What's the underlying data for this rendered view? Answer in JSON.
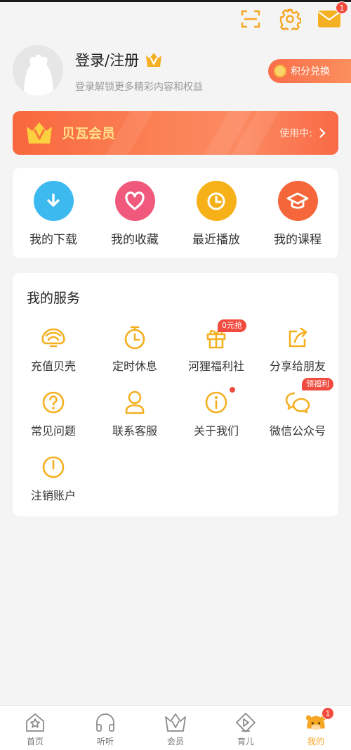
{
  "header": {
    "scan_icon": "scan-icon",
    "settings_icon": "gear-icon",
    "mail_icon": "mail-icon",
    "mail_badge": "1"
  },
  "profile": {
    "login_text": "登录/注册",
    "subtitle": "登录解锁更多精彩内容和权益",
    "points_label": "积分兑换"
  },
  "member": {
    "title": "贝瓦会员",
    "status": "使用中:"
  },
  "shortcuts": [
    {
      "label": "我的下载",
      "icon": "download-icon",
      "color": "#3cb9ef"
    },
    {
      "label": "我的收藏",
      "icon": "heart-icon",
      "color": "#f0597c"
    },
    {
      "label": "最近播放",
      "icon": "clock-icon",
      "color": "#f7b118"
    },
    {
      "label": "我的课程",
      "icon": "graduation-cap-icon",
      "color": "#f5673a"
    }
  ],
  "services": {
    "title": "我的服务",
    "items": [
      {
        "label": "充值贝壳",
        "icon": "shell-icon"
      },
      {
        "label": "定时休息",
        "icon": "timer-icon"
      },
      {
        "label": "河狸福利社",
        "icon": "gift-box-icon",
        "tag": "0元抢"
      },
      {
        "label": "分享给朋友",
        "icon": "share-icon"
      },
      {
        "label": "常见问题",
        "icon": "question-icon"
      },
      {
        "label": "联系客服",
        "icon": "customer-service-icon"
      },
      {
        "label": "关于我们",
        "icon": "info-icon"
      },
      {
        "label": "微信公众号",
        "icon": "wechat-icon",
        "tag": "领福利"
      },
      {
        "label": "注销账户",
        "icon": "power-icon"
      }
    ]
  },
  "nav": [
    {
      "label": "首页",
      "icon": "home-icon"
    },
    {
      "label": "听听",
      "icon": "headphones-icon"
    },
    {
      "label": "会员",
      "icon": "crown-icon"
    },
    {
      "label": "育儿",
      "icon": "play-diamond-icon"
    },
    {
      "label": "我的",
      "icon": "profile-mascot-icon",
      "badge": "1",
      "active": true
    }
  ],
  "colors": {
    "accent": "#f5a623",
    "member_gradient_start": "#f9673e",
    "badge_red": "#f24a3d"
  }
}
